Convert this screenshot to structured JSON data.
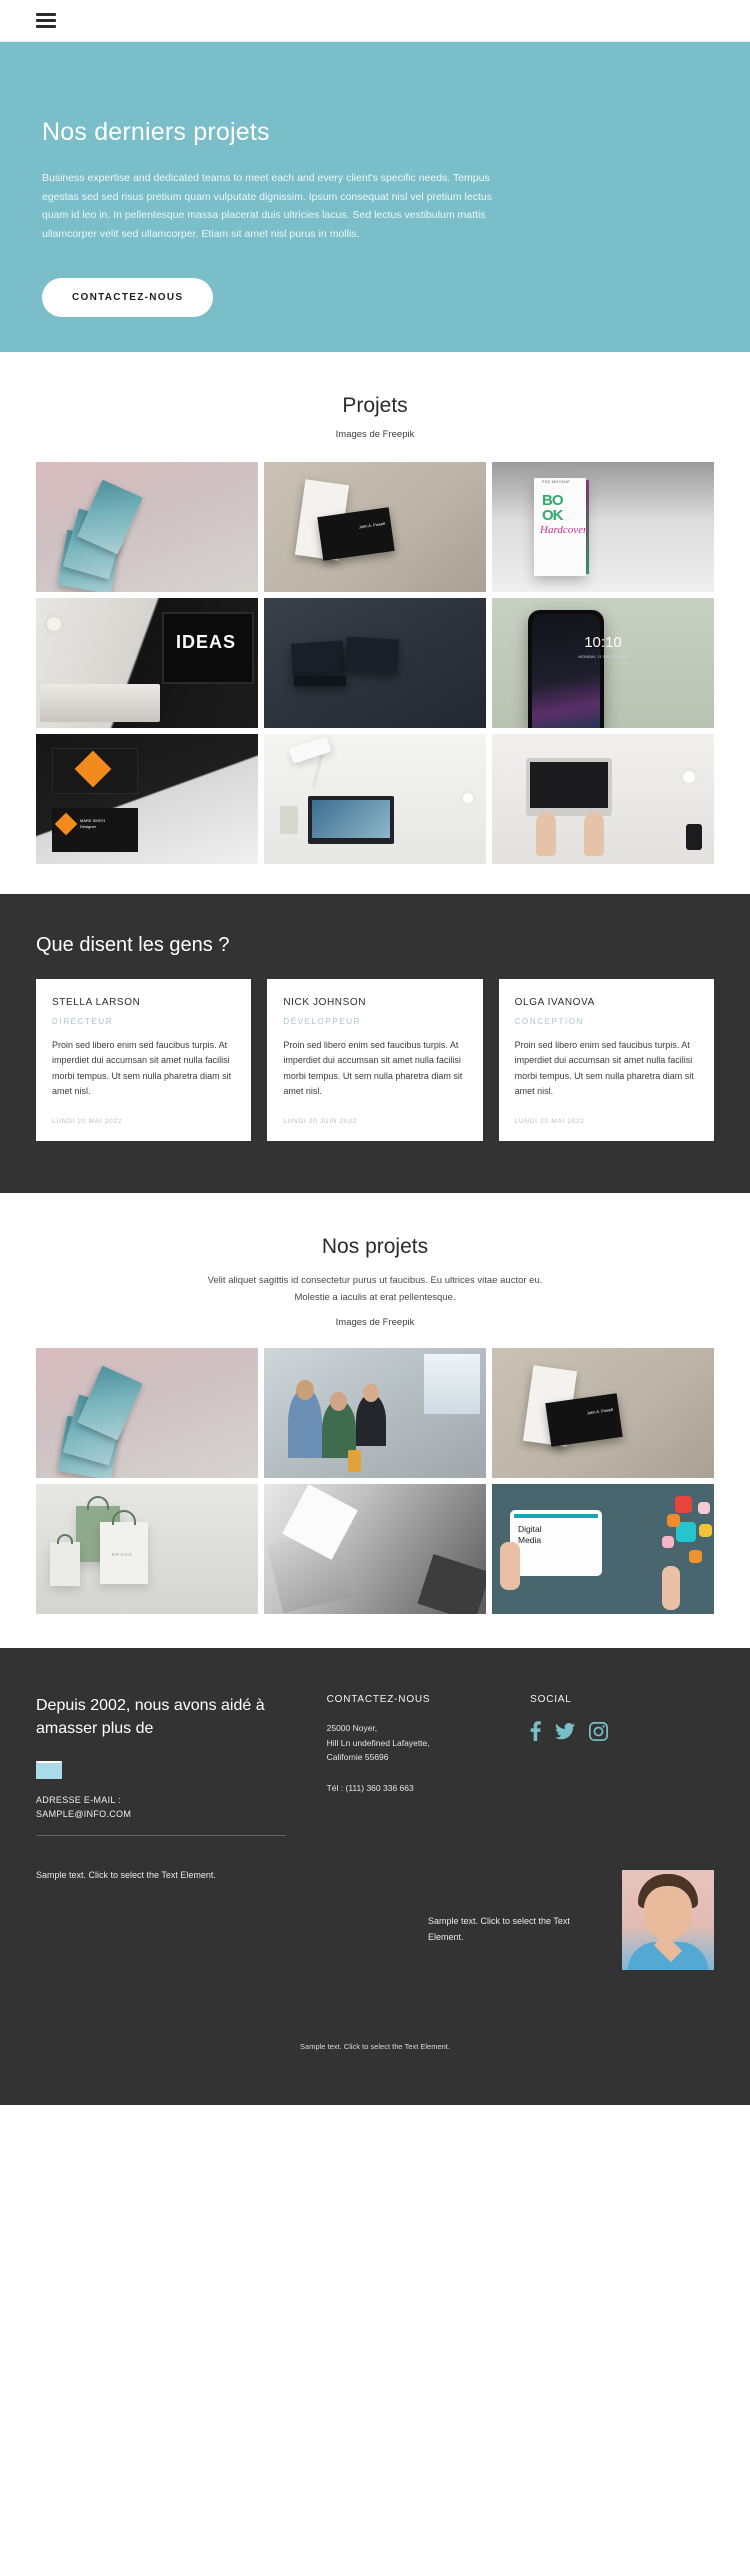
{
  "header": {
    "menu_icon": "hamburger-menu-icon"
  },
  "hero": {
    "title": "Nos derniers projets",
    "paragraph": "Business expertise and dedicated teams to meet each and every client's specific needs. Tempus egestas sed sed risus pretium quam vulputate dignissim. Ipsum consequat nisl vel pretium lectus quam id leo in. In pellentesque massa placerat duis ultricies lacus. Sed lectus vestibulum mattis ullamcorper velit sed ullamcorper. Etiam sit amet nisl purus in mollis.",
    "cta_label": "CONTACTEZ-NOUS",
    "bg_color": "#79bec8"
  },
  "projects_section": {
    "title": "Projets",
    "credit": "Images de Freepik",
    "tiles": [
      {
        "alt": "book-covers-mockup-stack"
      },
      {
        "alt": "business-cards-black-white"
      },
      {
        "alt": "book-hardcover-psd-mockup"
      },
      {
        "alt": "laptop-desk-ideas-screen"
      },
      {
        "alt": "dark-business-cards-pair"
      },
      {
        "alt": "smartphone-lockscreen-1010"
      },
      {
        "alt": "orange-black-branding-cards"
      },
      {
        "alt": "desk-lamp-laptop-stationery"
      },
      {
        "alt": "workspace-hands-laptop-topview"
      }
    ]
  },
  "testimonials": {
    "title": "Que disent les gens ?",
    "items": [
      {
        "name": "STELLA LARSON",
        "role": "DIRECTEUR",
        "quote": "Proin sed libero enim sed faucibus turpis. At imperdiet dui accumsan sit amet nulla facilisi morbi tempus. Ut sem nulla pharetra diam sit amet nisl.",
        "date": "LUNDI 20 MAI 2022"
      },
      {
        "name": "NICK JOHNSON",
        "role": "DÉVELOPPEUR",
        "quote": "Proin sed libero enim sed faucibus turpis. At imperdiet dui accumsan sit amet nulla facilisi morbi tempus. Ut sem nulla pharetra diam sit amet nisl.",
        "date": "LUNDI 20 JUIN 2022"
      },
      {
        "name": "OLGA IVANOVA",
        "role": "CONCEPTION",
        "quote": "Proin sed libero enim sed faucibus turpis. At imperdiet dui accumsan sit amet nulla facilisi morbi tempus. Ut sem nulla pharetra diam sit amet nisl.",
        "date": "LUNDI 20 MAI 2022"
      }
    ]
  },
  "our_projects_section": {
    "title": "Nos projets",
    "subtitle_line1": "Velit aliquet sagittis id consectetur purus ut faucibus. Eu ultrices vitae auctor eu.",
    "subtitle_line2": "Molestie a iaculis at erat pellentesque.",
    "credit": "Images de Freepik",
    "tiles": [
      {
        "alt": "book-covers-mockup-stack"
      },
      {
        "alt": "team-meeting-office"
      },
      {
        "alt": "business-cards-black-white"
      },
      {
        "alt": "paper-shopping-bags-brand"
      },
      {
        "alt": "abstract-grey-paper-folds"
      },
      {
        "alt": "digital-media-tablet-icons"
      }
    ]
  },
  "footer": {
    "headline": "Depuis 2002, nous avons aidé à amasser plus de",
    "mail_icon": "envelope-icon",
    "email_label_line1": "ADRESSE E-MAIL :",
    "email_label_line2": "SAMPLE@INFO.COM",
    "contact": {
      "title": "CONTACTEZ-NOUS",
      "address_line1": "25000 Noyer,",
      "address_line2": "Hill Ln undefined Lafayette,",
      "address_line3": "Californie 55696",
      "phone": "Tél :  (111) 360 336 663"
    },
    "social": {
      "title": "SOCIAL",
      "icons": [
        "facebook-icon",
        "twitter-icon",
        "instagram-icon"
      ],
      "color": "#79bec8"
    },
    "sample_left": "Sample text. Click to select the Text Element.",
    "sample_right": "Sample text. Click to select the Text Element.",
    "sample_bottom": "Sample text. Click to select the Text Element.",
    "avatar_alt": "young-man-portrait"
  }
}
